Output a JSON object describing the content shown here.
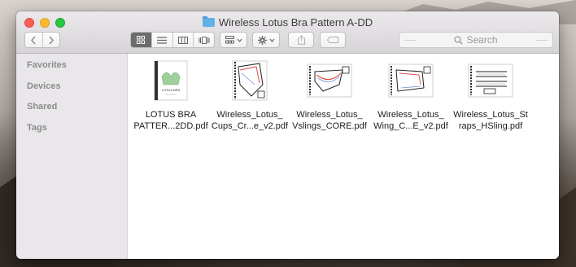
{
  "window": {
    "title": "Wireless Lotus Bra Pattern A-DD",
    "folder_icon": "folder-icon"
  },
  "toolbar": {
    "back_icon": "chevron-left-icon",
    "forward_icon": "chevron-right-icon",
    "view_modes": [
      "icon-view-icon",
      "list-view-icon",
      "column-view-icon",
      "cover-flow-icon"
    ],
    "active_view": "icon-view-icon",
    "arrange_icon": "arrange-icon",
    "action_icon": "gear-icon",
    "share_icon": "share-icon",
    "tags_icon": "tag-icon"
  },
  "search": {
    "placeholder": "Search"
  },
  "sidebar": {
    "items": [
      {
        "label": "Favorites"
      },
      {
        "label": "Devices"
      },
      {
        "label": "Shared"
      },
      {
        "label": "Tags"
      }
    ]
  },
  "files": [
    {
      "line1": "LOTUS BRA",
      "line2": "PATTER...2DD.pdf",
      "thumb_text": "LOTUS BRA"
    },
    {
      "line1": "Wireless_Lotus_",
      "line2": "Cups_Cr...e_v2.pdf"
    },
    {
      "line1": "Wireless_Lotus_",
      "line2": "Vslings_CORE.pdf"
    },
    {
      "line1": "Wireless_Lotus_",
      "line2": "Wing_C...E_v2.pdf"
    },
    {
      "line1": "Wireless_Lotus_St",
      "line2": "raps_HSling.pdf"
    }
  ],
  "colors": {
    "close": "#fc5f57",
    "minimize": "#fdbc2e",
    "maximize": "#28c840",
    "folder": "#5fb1e8",
    "pattern_red": "#d94a4a",
    "pattern_blue": "#6b8fd6",
    "cover_green": "#9fcf9a"
  }
}
